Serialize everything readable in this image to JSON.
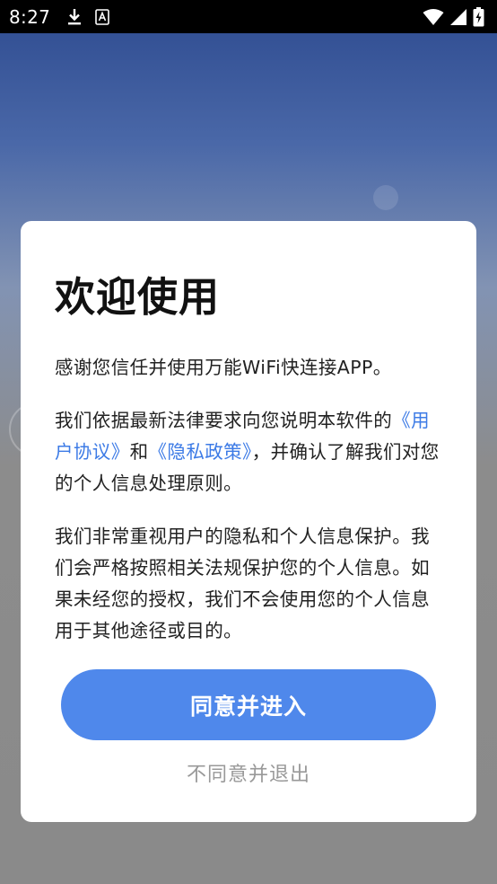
{
  "status_bar": {
    "time": "8:27",
    "left_icons": [
      "download-icon",
      "keyboard-a-icon"
    ],
    "right_icons": [
      "wifi-icon",
      "signal-icon",
      "battery-charging-icon"
    ]
  },
  "dialog": {
    "title": "欢迎使用",
    "paragraph1": "感谢您信任并使用万能WiFi快连接APP。",
    "paragraph2": {
      "part1": "我们依据最新法律要求向您说明本软件的",
      "link_user_agreement": "《用户协议》",
      "part2": "和",
      "link_privacy_policy": "《隐私政策》",
      "part3": "，并确认了解我们对您的个人信息处理原则。"
    },
    "paragraph3": "我们非常重视用户的隐私和个人信息保护。我们会严格按照相关法规保护您的个人信息。如果未经您的授权，我们不会使用您的个人信息用于其他途径或目的。",
    "agree_button": "同意并进入",
    "disagree_link": "不同意并退出"
  },
  "colors": {
    "accent": "#4f88eb",
    "link": "#3d7be6",
    "muted": "#999999"
  }
}
